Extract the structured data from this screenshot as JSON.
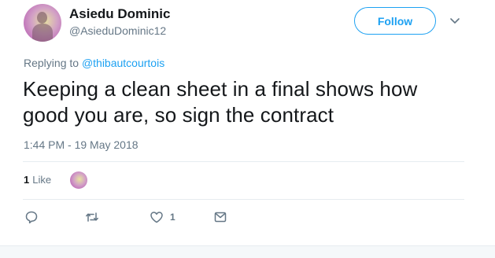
{
  "author": {
    "name": "Asiedu Dominic",
    "handle": "@AsieduDominic12"
  },
  "follow_button": {
    "label": "Follow"
  },
  "reply_context": {
    "prefix": "Replying to ",
    "mention": "@thibautcourtois"
  },
  "tweet": {
    "text": "Keeping a clean sheet in a final shows how good you are, so sign the contract",
    "timestamp": "1:44 PM - 19 May 2018"
  },
  "stats": {
    "likes_count": "1",
    "likes_label": "Like"
  },
  "actions": {
    "reply_icon": "reply-icon",
    "retweet_icon": "retweet-icon",
    "like_icon": "heart-icon",
    "like_count": "1",
    "dm_icon": "message-icon"
  },
  "colors": {
    "accent": "#1da1f2",
    "secondary_text": "#657786",
    "primary_text": "#14171a"
  }
}
